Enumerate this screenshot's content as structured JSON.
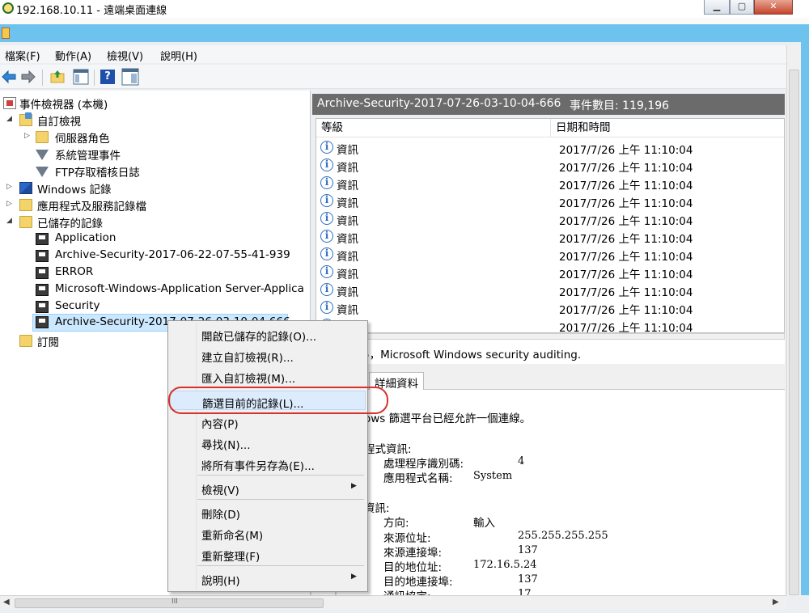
{
  "rdp": {
    "title": "192.168.10.11 - 遠端桌面連線",
    "min_label": "▁",
    "max_label": "▢",
    "close_label": "✕"
  },
  "menubar": [
    "檔案(F)",
    "動作(A)",
    "檢視(V)",
    "說明(H)"
  ],
  "toolbar": {
    "icons": [
      "back-arrow-icon",
      "forward-arrow-icon",
      "up-folder-icon",
      "show-hide-console-tree-icon",
      "help-icon",
      "show-hide-action-pane-icon"
    ],
    "help_label": "?"
  },
  "tree": {
    "root": "事件檢視器 (本機)",
    "custom_views": "自訂檢視",
    "server_roles": "伺服器角色",
    "admin_events": "系統管理事件",
    "ftp_audit": "FTP存取稽核日誌",
    "windows_logs": "Windows 記錄",
    "apps_services_logs": "應用程式及服務記錄檔",
    "saved_logs": "已儲存的記錄",
    "saved_items": [
      "Application",
      "Archive-Security-2017-06-22-07-55-41-939",
      "ERROR",
      "Microsoft-Windows-Application Server-Applica",
      "Security",
      "Archive-Security-2017-07-26-03-10-04-666"
    ],
    "subscriptions": "訂閱"
  },
  "log_header": {
    "name": "Archive-Security-2017-07-26-03-10-04-666",
    "count": "事件數目: 119,196"
  },
  "table": {
    "col_level": "等級",
    "col_datetime": "日期和時間",
    "info_glyph": "i",
    "rows": [
      {
        "level": "資訊",
        "datetime": "2017/7/26 上午 11:10:04"
      },
      {
        "level": "資訊",
        "datetime": "2017/7/26 上午 11:10:04"
      },
      {
        "level": "資訊",
        "datetime": "2017/7/26 上午 11:10:04"
      },
      {
        "level": "資訊",
        "datetime": "2017/7/26 上午 11:10:04"
      },
      {
        "level": "資訊",
        "datetime": "2017/7/26 上午 11:10:04"
      },
      {
        "level": "資訊",
        "datetime": "2017/7/26 上午 11:10:04"
      },
      {
        "level": "資訊",
        "datetime": "2017/7/26 上午 11:10:04"
      },
      {
        "level": "資訊",
        "datetime": "2017/7/26 上午 11:10:04"
      },
      {
        "level": "資訊",
        "datetime": "2017/7/26 上午 11:10:04"
      },
      {
        "level": "資訊",
        "datetime": "2017/7/26 上午 11:10:04"
      },
      {
        "level": "資訊",
        "datetime": "2017/7/26 上午 11:10:04"
      }
    ]
  },
  "detail": {
    "description": "5，Microsoft Windows security auditing.",
    "tab_details": "詳細資料",
    "summary": "ows 篩選平台已經允許一個連線。",
    "app_info_header": "程式資訊:",
    "process_id_label": "處理程序識別碼:",
    "process_id_value": "4",
    "app_name_label": "應用程式名稱:",
    "app_name_value": "System",
    "network_header": "資訊:",
    "direction_label": "方向:",
    "direction_value": "輸入",
    "src_addr_label": "來源位址:",
    "src_addr_value": "255.255.255.255",
    "src_port_label": "來源連接埠:",
    "src_port_value": "137",
    "dst_addr_label": "目的地位址:",
    "dst_addr_value": "172.16.5.24",
    "dst_port_label": "目的地連接埠:",
    "dst_port_value": "137",
    "protocol_label": "通訊協定:",
    "protocol_value": "17"
  },
  "context_menu": {
    "items": [
      {
        "label": "開啟已儲存的記錄(O)..."
      },
      {
        "label": "建立自訂檢視(R)..."
      },
      {
        "label": "匯入自訂檢視(M)..."
      },
      {
        "label": "篩選目前的記錄(L)..."
      },
      {
        "label": "內容(P)"
      },
      {
        "label": "尋找(N)..."
      },
      {
        "label": "將所有事件另存為(E)..."
      },
      {
        "label": "檢視(V)"
      },
      {
        "label": "刪除(D)"
      },
      {
        "label": "重新命名(M)"
      },
      {
        "label": "重新整理(F)"
      },
      {
        "label": "說明(H)"
      }
    ],
    "highlight_color": "#d9312b"
  },
  "scroll": {
    "grip": "III"
  }
}
